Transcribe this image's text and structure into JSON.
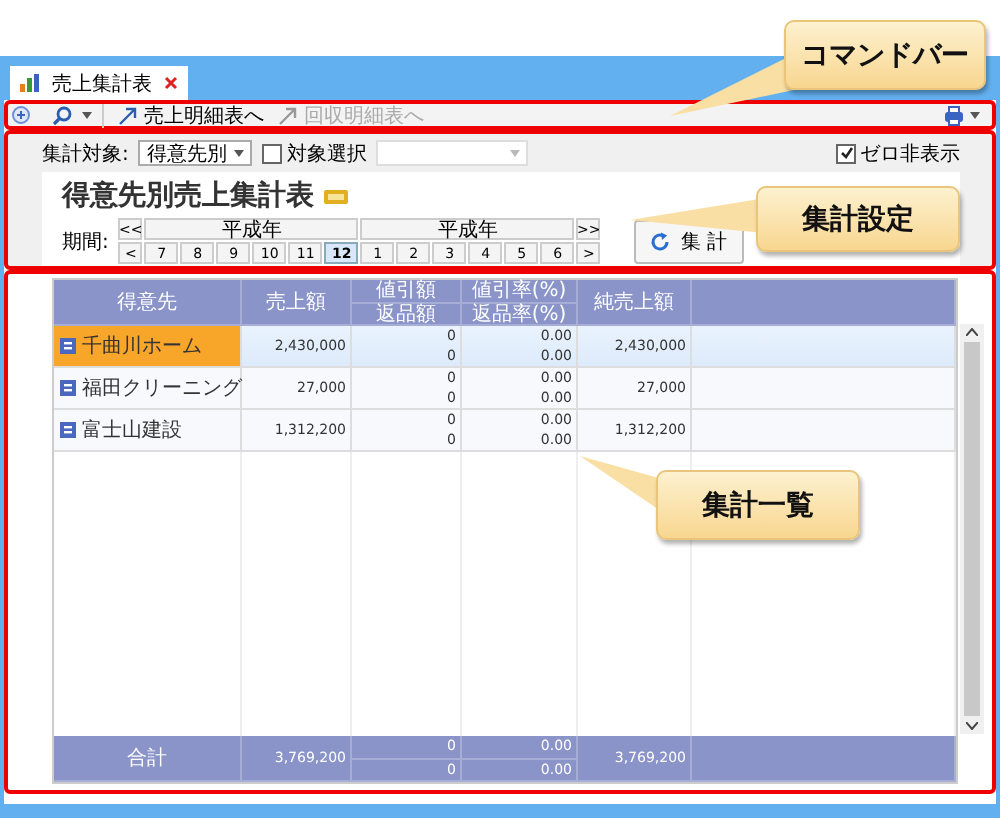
{
  "tab": {
    "label": "売上集計表"
  },
  "command_bar": {
    "links": [
      {
        "label": "売上明細表へ",
        "disabled": false
      },
      {
        "label": "回収明細表へ",
        "disabled": true
      }
    ]
  },
  "settings": {
    "target_label": "集計対象:",
    "target_value": "得意先別",
    "select_target": {
      "label": "対象選択",
      "checked": false
    },
    "hide_zero": {
      "label": "ゼロ非表示",
      "checked": true
    },
    "title": "得意先別売上集計表",
    "period_label": "期間:",
    "prev_year": "<<",
    "next_year": ">>",
    "prev": "<",
    "next": ">",
    "years": [
      "平成年",
      "平成年"
    ],
    "months": [
      {
        "label": "7",
        "selected": false
      },
      {
        "label": "8",
        "selected": false
      },
      {
        "label": "9",
        "selected": false
      },
      {
        "label": "10",
        "selected": false
      },
      {
        "label": "11",
        "selected": false
      },
      {
        "label": "12",
        "selected": true
      },
      {
        "label": "1",
        "selected": false
      },
      {
        "label": "2",
        "selected": false
      },
      {
        "label": "3",
        "selected": false
      },
      {
        "label": "4",
        "selected": false
      },
      {
        "label": "5",
        "selected": false
      },
      {
        "label": "6",
        "selected": false
      }
    ],
    "run_button": "集 計"
  },
  "table": {
    "columns": [
      {
        "label": "得意先"
      },
      {
        "label": "売上額"
      },
      {
        "label": "値引額",
        "sub": "返品額"
      },
      {
        "label": "値引率(%)",
        "sub": "返品率(%)"
      },
      {
        "label": "純売上額"
      }
    ],
    "rows": [
      {
        "customer": "千曲川ホーム",
        "selected": true,
        "sales": "2,430,000",
        "discount": "0",
        "returns": "0",
        "discount_rate": "0.00",
        "return_rate": "0.00",
        "net": "2,430,000"
      },
      {
        "customer": "福田クリーニング",
        "selected": false,
        "sales": "27,000",
        "discount": "0",
        "returns": "0",
        "discount_rate": "0.00",
        "return_rate": "0.00",
        "net": "27,000"
      },
      {
        "customer": "富士山建設",
        "selected": false,
        "sales": "1,312,200",
        "discount": "0",
        "returns": "0",
        "discount_rate": "0.00",
        "return_rate": "0.00",
        "net": "1,312,200"
      }
    ],
    "footer": {
      "label": "合計",
      "sales": "3,769,200",
      "discount": "0",
      "returns": "0",
      "discount_rate": "0.00",
      "return_rate": "0.00",
      "net": "3,769,200"
    }
  },
  "callouts": [
    {
      "text": "コマンドバー"
    },
    {
      "text": "集計設定"
    },
    {
      "text": "集計一覧"
    }
  ]
}
